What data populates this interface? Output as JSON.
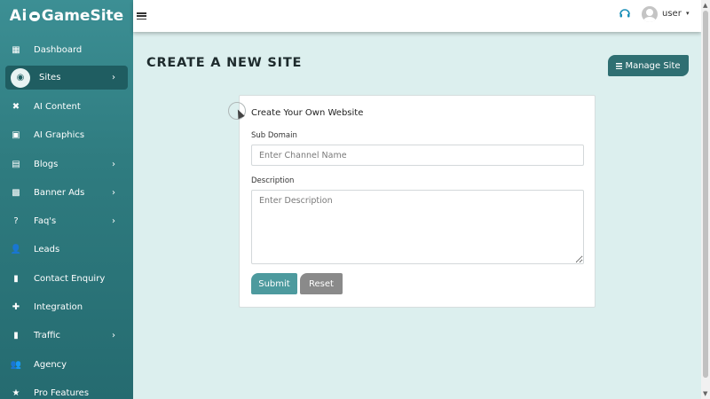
{
  "brand": {
    "part1": "Ai",
    "part2": "GameSite"
  },
  "sidebar": {
    "items": [
      {
        "label": "Dashboard",
        "icon": "dashboard-icon",
        "glyph": "▦",
        "chevron": false
      },
      {
        "label": "Sites",
        "icon": "globe-icon",
        "glyph": "◉",
        "chevron": true,
        "active": true
      },
      {
        "label": "AI Content",
        "icon": "tools-icon",
        "glyph": "✖",
        "chevron": false
      },
      {
        "label": "AI Graphics",
        "icon": "image-icon",
        "glyph": "▣",
        "chevron": false
      },
      {
        "label": "Blogs",
        "icon": "blog-icon",
        "glyph": "▤",
        "chevron": true
      },
      {
        "label": "Banner Ads",
        "icon": "ad-icon",
        "glyph": "▩",
        "chevron": true
      },
      {
        "label": "Faq's",
        "icon": "question-icon",
        "glyph": "?",
        "chevron": true
      },
      {
        "label": "Leads",
        "icon": "user-plus-icon",
        "glyph": "👤",
        "chevron": false
      },
      {
        "label": "Contact Enquiry",
        "icon": "contact-icon",
        "glyph": "▮",
        "chevron": false
      },
      {
        "label": "Integration",
        "icon": "puzzle-icon",
        "glyph": "✚",
        "chevron": false
      },
      {
        "label": "Traffic",
        "icon": "traffic-icon",
        "glyph": "▮",
        "chevron": true
      },
      {
        "label": "Agency",
        "icon": "users-icon",
        "glyph": "👥",
        "chevron": false
      },
      {
        "label": "Pro Features",
        "icon": "star-icon",
        "glyph": "★",
        "chevron": false
      }
    ],
    "chevron_glyph": "›"
  },
  "topbar": {
    "user": "user",
    "caret": "▾"
  },
  "main": {
    "title": "CREATE A NEW SITE",
    "manage_button": "Manage Site",
    "card": {
      "title": "Create Your Own Website",
      "subdomain_label": "Sub Domain",
      "subdomain_placeholder": "Enter Channel Name",
      "subdomain_value": "",
      "description_label": "Description",
      "description_placeholder": "Enter Description",
      "description_value": "",
      "submit": "Submit",
      "reset": "Reset"
    }
  },
  "colors": {
    "sidebar": "#2f7c80",
    "accent": "#2f6f72",
    "submit": "#4d9a9e",
    "reset": "#8a8a8a",
    "background": "#dcefee"
  }
}
